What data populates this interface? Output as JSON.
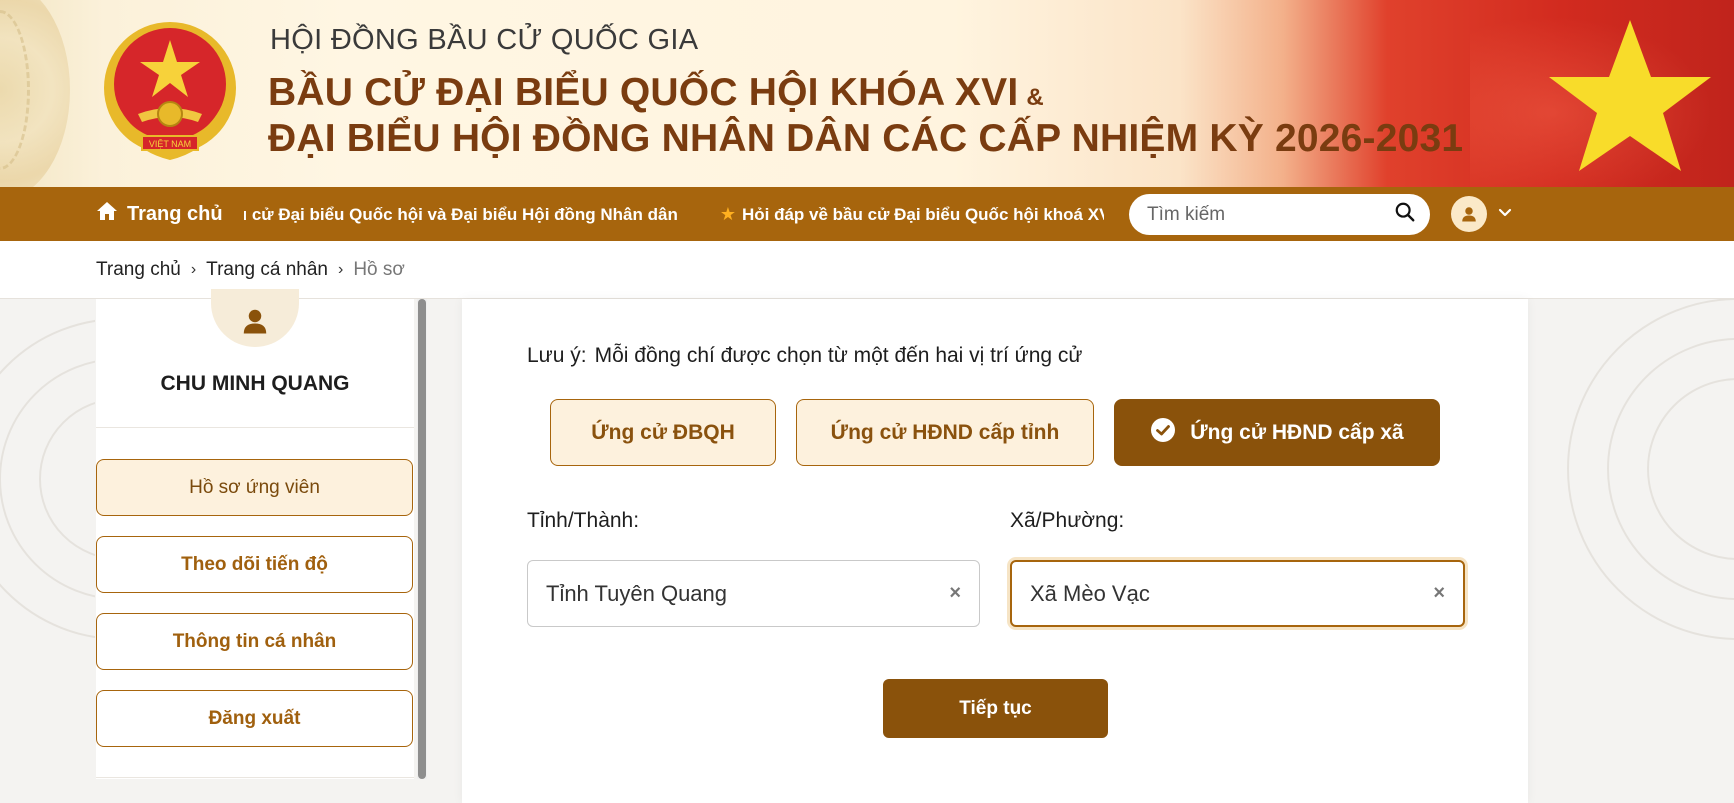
{
  "header": {
    "council": "HỘI ĐỒNG BẦU CỬ QUỐC GIA",
    "title_line1": "BẦU CỬ ĐẠI BIỂU QUỐC HỘI KHÓA XVI",
    "ampersand": "&",
    "title_line2": "ĐẠI BIỂU HỘI ĐỒNG NHÂN DÂN CÁC CẤP NHIỆM KỲ 2026-2031",
    "emblem_text": "VIỆT NAM"
  },
  "nav": {
    "home_label": "Trang chủ",
    "home_icon": "home-icon",
    "ticker": [
      "iu cử Đại biểu Quốc hội và Đại biểu Hội đồng Nhân dân",
      "Hỏi đáp về bầu cử Đại biểu Quốc hội khoá XVI"
    ],
    "search_placeholder": "Tìm kiếm",
    "search_icon": "search-icon",
    "user_icon": "user-icon",
    "dropdown_icon": "chevron-down-icon"
  },
  "breadcrumb": {
    "items": [
      "Trang chủ",
      "Trang cá nhân"
    ],
    "current": "Hồ sơ",
    "separator": "›"
  },
  "sidebar": {
    "name": "CHU MINH QUANG",
    "items": [
      {
        "label": "Hồ sơ ứng viên",
        "active": true
      },
      {
        "label": "Theo dõi tiến độ",
        "active": false
      },
      {
        "label": "Thông tin cá nhân",
        "active": false
      },
      {
        "label": "Đăng xuất",
        "active": false
      }
    ]
  },
  "main": {
    "note_label": "Lưu ý:",
    "note_text": "Mỗi đồng chí được chọn từ một đến hai vị trí ứng cử",
    "choices": [
      {
        "label": "Ứng cử ĐBQH",
        "selected": false
      },
      {
        "label": "Ứng cử HĐND cấp tỉnh",
        "selected": false
      },
      {
        "label": "Ứng cử HĐND cấp xã",
        "selected": true
      }
    ],
    "province_label": "Tỉnh/Thành:",
    "province_value": "Tỉnh Tuyên Quang",
    "ward_label": "Xã/Phường:",
    "ward_value": "Xã Mèo Vạc",
    "clear_symbol": "×",
    "continue_label": "Tiếp tục"
  },
  "colors": {
    "brand": "#a7650d",
    "brand_dark": "#8a520b",
    "brand_light": "#fdf1dd",
    "title": "#7a3c10"
  }
}
